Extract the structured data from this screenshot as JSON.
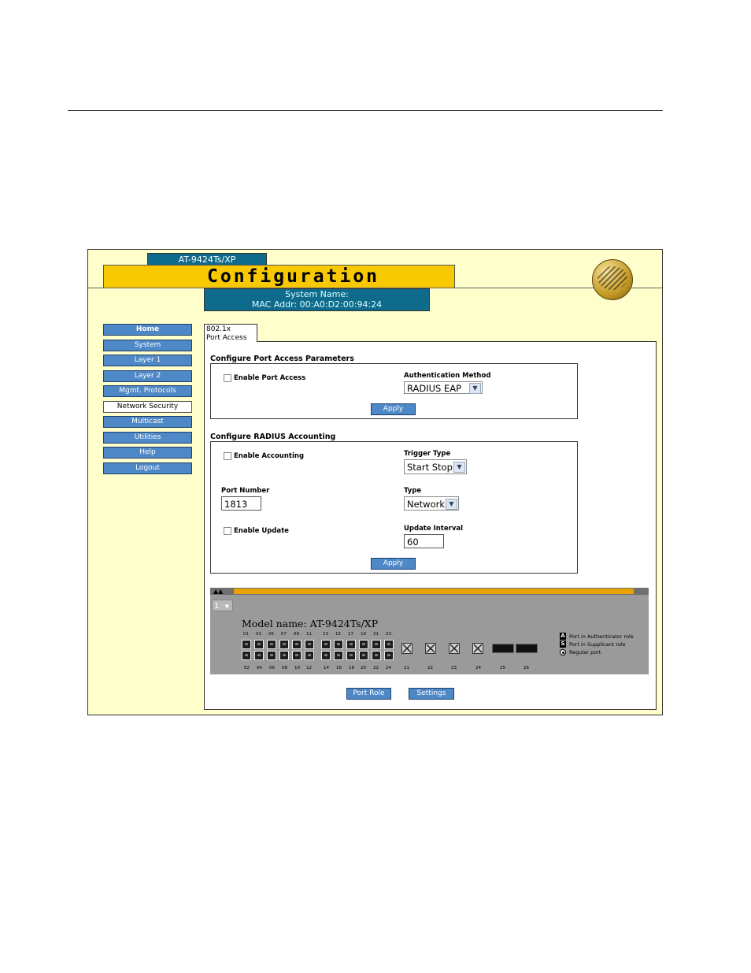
{
  "header": {
    "model_tab": "AT-9424Ts/XP",
    "title": "Configuration",
    "system_name_label": "System Name:",
    "mac_addr": "MAC Addr: 00:A0:D2:00:94:24"
  },
  "nav": {
    "items": [
      {
        "label": "Home"
      },
      {
        "label": "System"
      },
      {
        "label": "Layer 1"
      },
      {
        "label": "Layer 2"
      },
      {
        "label": "Mgmt. Protocols"
      },
      {
        "label": "Network Security"
      },
      {
        "label": "Multicast"
      },
      {
        "label": "Utilities"
      },
      {
        "label": "Help"
      },
      {
        "label": "Logout"
      }
    ],
    "active": "Network Security"
  },
  "tab": {
    "line1": "802.1x",
    "line2": "Port Access"
  },
  "port_access": {
    "section_title": "Configure Port Access Parameters",
    "enable_label": "Enable Port Access",
    "auth_method_label": "Authentication Method",
    "auth_method_value": "RADIUS EAP",
    "apply_label": "Apply"
  },
  "radius": {
    "section_title": "Configure RADIUS Accounting",
    "enable_accounting_label": "Enable Accounting",
    "trigger_type_label": "Trigger Type",
    "trigger_type_value": "Start Stop",
    "port_number_label": "Port Number",
    "port_number_value": "1813",
    "type_label": "Type",
    "type_value": "Network",
    "enable_update_label": "Enable Update",
    "update_interval_label": "Update Interval",
    "update_interval_value": "60",
    "apply_label": "Apply"
  },
  "switch_panel": {
    "unit_value": "1",
    "model_name": "Model name: AT-9424Ts/XP",
    "top_port_numbers": [
      "01",
      "03",
      "05",
      "07",
      "09",
      "11",
      "13",
      "15",
      "17",
      "19",
      "21",
      "23"
    ],
    "bottom_port_numbers": [
      "02",
      "04",
      "06",
      "08",
      "10",
      "12",
      "14",
      "16",
      "18",
      "20",
      "22",
      "24"
    ],
    "uplink_numbers": [
      "21",
      "22",
      "23",
      "24"
    ],
    "fiber_numbers": [
      "25",
      "26"
    ],
    "legend": {
      "authenticator_symbol": "A",
      "authenticator": "Port in Authenticator role",
      "supplicant_symbol": "S",
      "supplicant": "Port in Supplicant role",
      "regular": "Regular port"
    }
  },
  "footer_buttons": {
    "port_role": "Port Role",
    "settings": "Settings"
  }
}
